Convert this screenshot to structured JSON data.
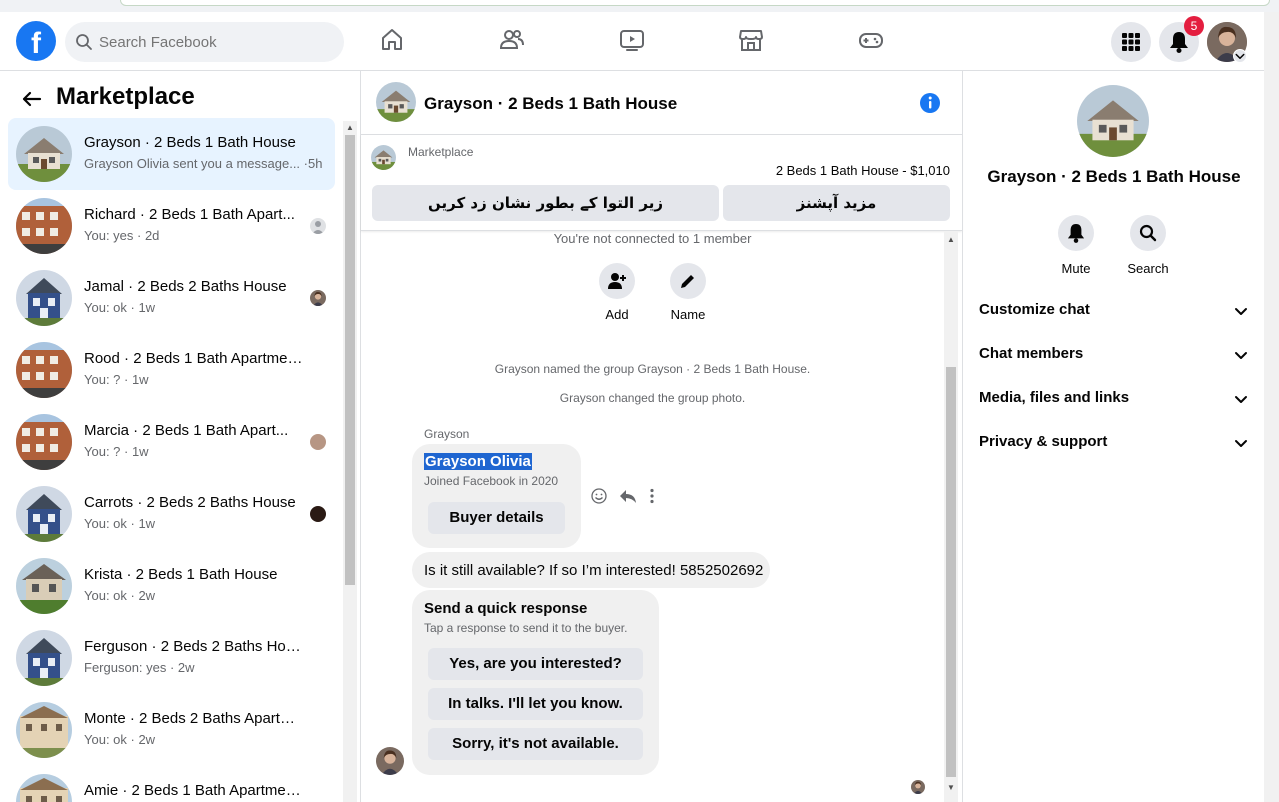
{
  "topnav": {
    "logo": "f",
    "search_placeholder": "Search Facebook",
    "notification_count": "5"
  },
  "sidebar": {
    "title": "Marketplace",
    "conversations": [
      {
        "name": "Grayson · 2 Beds 1 Bath House",
        "sub": "Grayson Olivia sent you a message... ·5h",
        "active": true
      },
      {
        "name": "Richard · 2 Beds 1 Bath Apart...",
        "sub": "You: yes · 2d"
      },
      {
        "name": "Jamal · 2 Beds 2 Baths House",
        "sub": "You: ok · 1w"
      },
      {
        "name": "Rood · 2 Beds 1 Bath Apartment...",
        "sub": "You: ? · 1w"
      },
      {
        "name": "Marcia · 2 Beds 1 Bath Apart...",
        "sub": "You: ? · 1w"
      },
      {
        "name": "Carrots · 2 Beds 2 Baths House",
        "sub": "You: ok · 1w"
      },
      {
        "name": "Krista · 2 Beds 1 Bath House",
        "sub": "You: ok · 2w"
      },
      {
        "name": "Ferguson · 2 Beds 2 Baths House",
        "sub": "Ferguson: yes · 2w"
      },
      {
        "name": "Monte · 2 Beds 2 Baths Apartm...",
        "sub": "You: ok · 2w"
      },
      {
        "name": "Amie · 2 Beds 1 Bath Apartment...",
        "sub": ""
      }
    ]
  },
  "chat": {
    "title": "Grayson · 2 Beds 1 Bath House",
    "listing_source": "Marketplace",
    "listing_price": "2 Beds 1 Bath House - $1,010",
    "btn_mark_pending": "زیر التوا کے بطور نشان زد کریں",
    "btn_more_options": "مزید آپشنز",
    "not_connected": "You're not connected to 1 member",
    "action_add": "Add",
    "action_name": "Name",
    "sys_named": "Grayson named the group Grayson · 2 Beds 1 Bath House.",
    "sys_photo": "Grayson changed the group photo.",
    "sender": "Grayson",
    "buyer_name": "Grayson Olivia",
    "buyer_joined": "Joined Facebook in 2020",
    "buyer_details_btn": "Buyer details",
    "message": "Is it still available? If so I’m interested! 5852502692",
    "quick_title": "Send a quick response",
    "quick_sub": "Tap a response to send it to the buyer.",
    "quick_replies": [
      "Yes, are you interested?",
      "In talks. I'll let you know.",
      "Sorry, it's not available."
    ]
  },
  "details": {
    "title": "Grayson · 2 Beds 1 Bath House",
    "mute": "Mute",
    "search": "Search",
    "sections": [
      "Customize chat",
      "Chat members",
      "Media, files and links",
      "Privacy & support"
    ]
  },
  "colors": {
    "brand": "#1877f2",
    "active_row": "#e7f3ff",
    "badge": "#e41e3f",
    "selection": "#1f66d1"
  }
}
